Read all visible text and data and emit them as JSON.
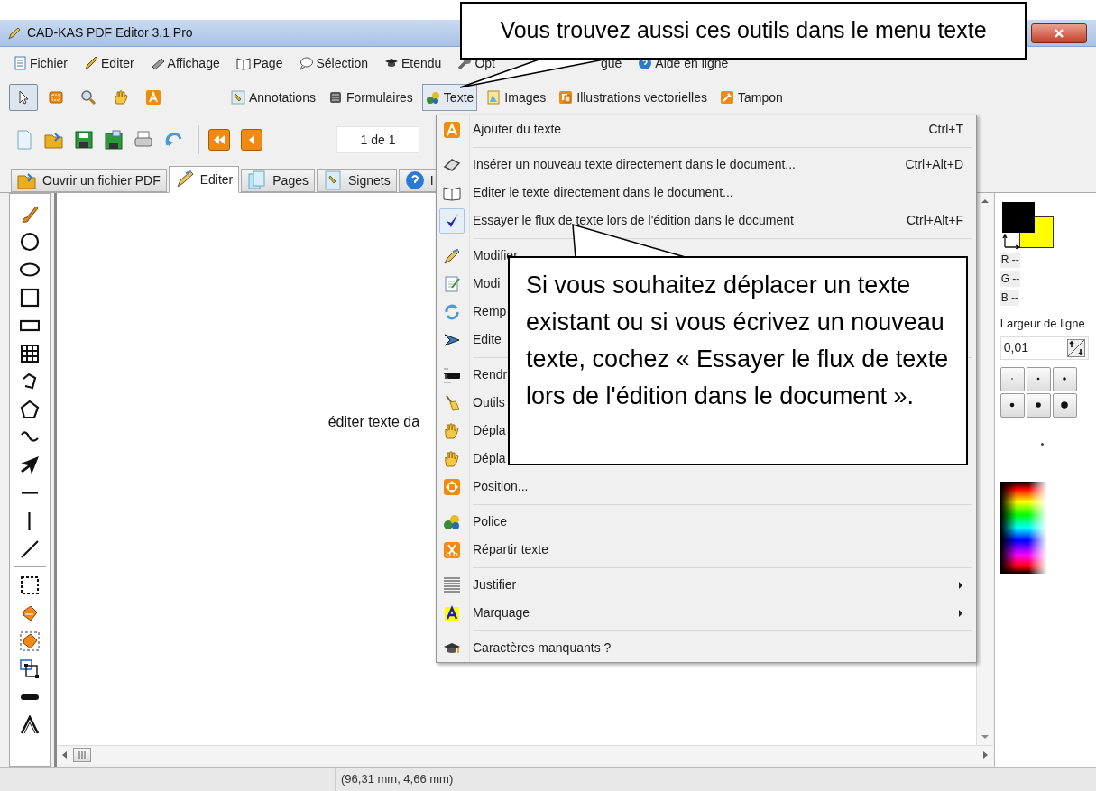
{
  "window": {
    "title": "CAD-KAS PDF Editor 3.1 Pro"
  },
  "menu_bar": [
    {
      "label": "Fichier"
    },
    {
      "label": "Editer"
    },
    {
      "label": "Affichage"
    },
    {
      "label": "Page"
    },
    {
      "label": "Sélection"
    },
    {
      "label": "Etendu"
    },
    {
      "label": "Opt"
    },
    {
      "label": "gue"
    },
    {
      "label": "Aide en ligne"
    }
  ],
  "tools": [
    {
      "selected": true
    },
    {
      "selected": false
    },
    {
      "selected": false
    },
    {
      "selected": false
    },
    {
      "selected": false
    }
  ],
  "toolbar_buttons": [
    {
      "label": "Annotations",
      "selected": false
    },
    {
      "label": "Formulaires",
      "selected": false
    },
    {
      "label": "Texte",
      "selected": true
    },
    {
      "label": "Images",
      "selected": false
    },
    {
      "label": "Illustrations vectorielles",
      "selected": false
    },
    {
      "label": "Tampon",
      "selected": false
    }
  ],
  "page_field": {
    "value": "1 de 1"
  },
  "tabs": [
    {
      "label": "Ouvrir un fichier PDF",
      "selected": false
    },
    {
      "label": "Editer",
      "selected": true
    },
    {
      "label": "Pages",
      "selected": false
    },
    {
      "label": "Signets",
      "selected": false
    },
    {
      "label": "I",
      "selected": false
    }
  ],
  "canvas": {
    "text": "éditer texte da"
  },
  "right_panel": {
    "r": "R --",
    "g": "G --",
    "b": "B --",
    "line_width_label": "Largeur de ligne",
    "line_width_value": "0,01"
  },
  "text_menu": {
    "groups": [
      {
        "items": [
          {
            "label": "Ajouter du texte",
            "shortcut": "Ctrl+T",
            "checked": false,
            "submenu": false
          }
        ]
      },
      {
        "items": [
          {
            "label": "Insérer un nouveau texte directement dans le document...",
            "shortcut": "Ctrl+Alt+D",
            "checked": false,
            "submenu": false
          },
          {
            "label": "Editer le texte directement dans le document...",
            "checked": false,
            "submenu": false
          },
          {
            "label": "Essayer le flux de texte lors de l'édition dans le document",
            "shortcut": "Ctrl+Alt+F",
            "checked": true,
            "submenu": false
          }
        ]
      },
      {
        "items": [
          {
            "label": "Modifier",
            "checked": false,
            "submenu": false
          },
          {
            "label": "Modi",
            "checked": false,
            "submenu": false
          },
          {
            "label": "Remp",
            "checked": false,
            "submenu": false
          },
          {
            "label": "Edite",
            "checked": false,
            "submenu": false
          }
        ]
      },
      {
        "items": [
          {
            "label": "Rendr",
            "checked": false,
            "submenu": false
          },
          {
            "label": "Outils",
            "checked": false,
            "submenu": false
          },
          {
            "label": "Dépla",
            "checked": false,
            "submenu": false
          },
          {
            "label": "Dépla",
            "checked": false,
            "submenu": false
          },
          {
            "label": "Position...",
            "checked": false,
            "submenu": false
          }
        ]
      },
      {
        "items": [
          {
            "label": "Police",
            "checked": false,
            "submenu": false
          },
          {
            "label": "Répartir texte",
            "checked": false,
            "submenu": false
          }
        ]
      },
      {
        "items": [
          {
            "label": "Justifier",
            "checked": false,
            "submenu": true
          },
          {
            "label": "Marquage",
            "checked": false,
            "submenu": true
          }
        ]
      },
      {
        "items": [
          {
            "label": "Caractères manquants ?",
            "checked": false,
            "submenu": false
          }
        ]
      }
    ]
  },
  "status_bar": {
    "coordinates": "(96,31 mm, 4,66 mm)"
  },
  "callouts": [
    {
      "text": "Vous trouvez aussi ces outils dans le menu texte"
    },
    {
      "text": "Si vous souhaitez déplacer un texte existant ou si vous écrivez un nouveau texte, cochez « Essayer le flux de texte lors de l'édition dans le document »."
    }
  ]
}
